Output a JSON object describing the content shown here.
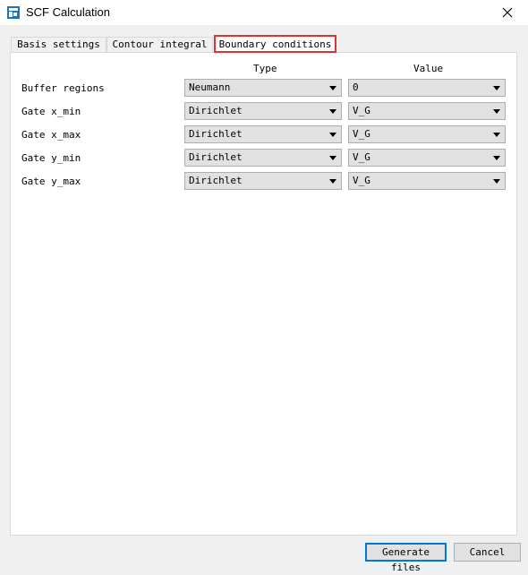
{
  "window": {
    "title": "SCF Calculation"
  },
  "tabs": [
    {
      "label": "Basis settings",
      "active": false
    },
    {
      "label": "Contour integral",
      "active": false
    },
    {
      "label": "Boundary conditions",
      "active": true
    }
  ],
  "headers": {
    "type": "Type",
    "value": "Value"
  },
  "rows": [
    {
      "label": "Buffer regions",
      "type": "Neumann",
      "value": "0"
    },
    {
      "label": "Gate x_min",
      "type": "Dirichlet",
      "value": "V_G"
    },
    {
      "label": "Gate x_max",
      "type": "Dirichlet",
      "value": "V_G"
    },
    {
      "label": "Gate y_min",
      "type": "Dirichlet",
      "value": "V_G"
    },
    {
      "label": "Gate y_max",
      "type": "Dirichlet",
      "value": "V_G"
    }
  ],
  "buttons": {
    "generate": "Generate files",
    "cancel": "Cancel"
  },
  "colors": {
    "highlight": "#e03030",
    "default_button_border": "#0078d7",
    "app_icon": "#1e73be"
  },
  "icons": {
    "app": "app-icon",
    "close": "close-icon",
    "dropdown": "chevron-down-icon"
  }
}
